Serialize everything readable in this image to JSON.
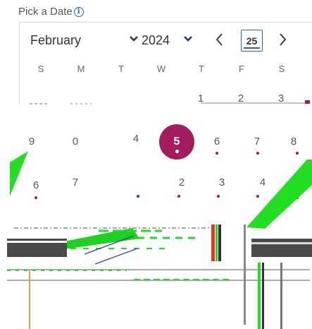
{
  "field": {
    "label": "Pick a Date",
    "info_icon": "info-circle-icon"
  },
  "header": {
    "month": "February",
    "year": "2024",
    "today_label": "25",
    "prev_icon": "chevron-left-icon",
    "next_icon": "chevron-right-icon",
    "dropdown_icon": "chevron-down-icon"
  },
  "weekdays": [
    "S",
    "M",
    "T",
    "W",
    "T",
    "F",
    "S"
  ],
  "days": {
    "row1": [
      "1",
      "2",
      "3"
    ],
    "row2": [
      "9",
      "0",
      "4",
      "5",
      "6",
      "7",
      "8"
    ],
    "row3": [
      "6",
      "7",
      "2",
      "3",
      "4"
    ]
  },
  "selected_day": "5",
  "colors": {
    "accent": "#a31c5e",
    "focus_border": "#2b5fa8",
    "glitch_green": "#22dd22",
    "glitch_red": "#e8332a"
  }
}
